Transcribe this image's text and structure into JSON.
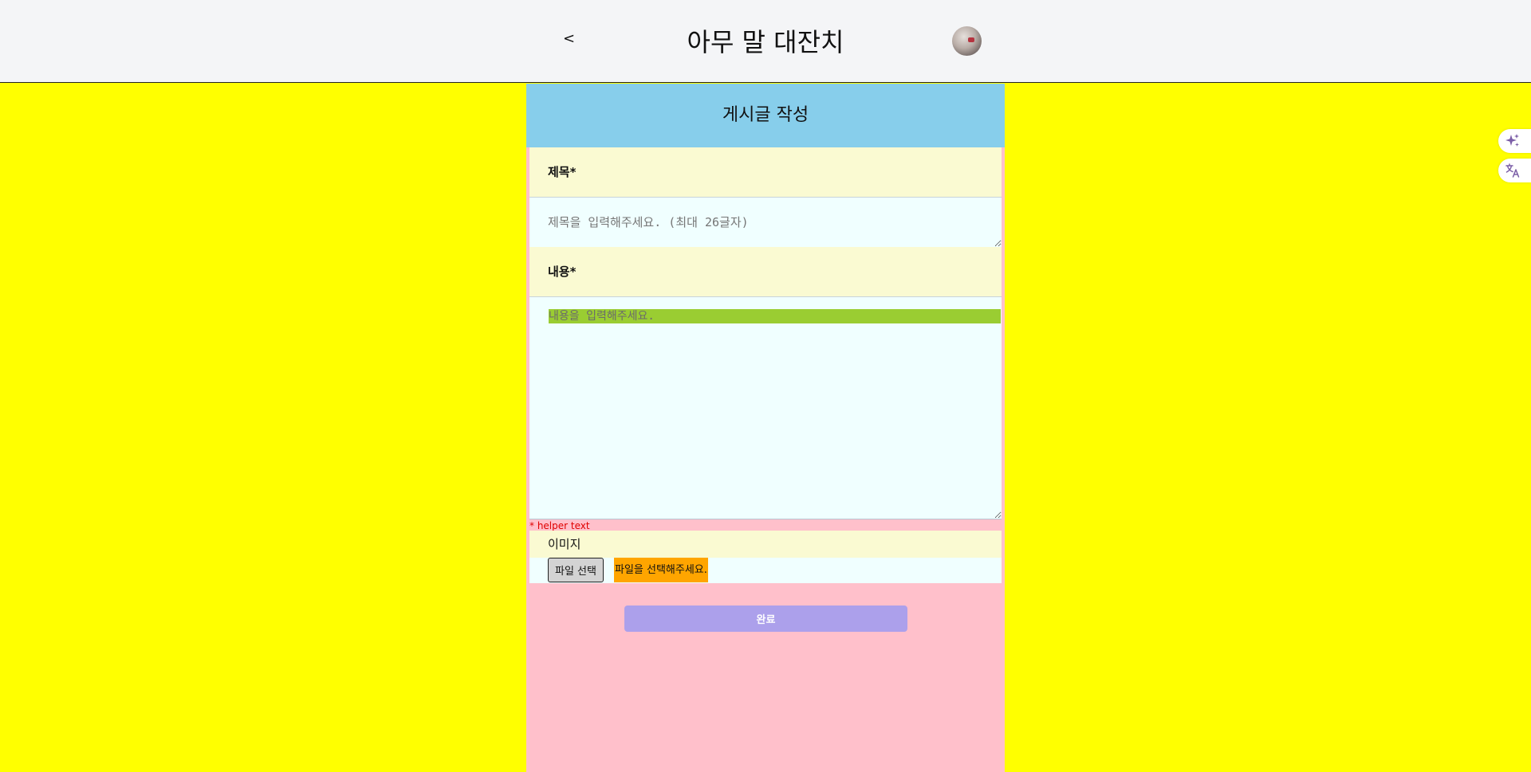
{
  "header": {
    "back_label": "<",
    "title": "아무 말 대잔치"
  },
  "form": {
    "heading": "게시글 작성",
    "title_label": "제목",
    "title_required": "*",
    "title_placeholder": "제목을 입력해주세요. (최대 26글자)",
    "title_value": "",
    "content_label": "내용",
    "content_required": "*",
    "content_placeholder": "내용을 입력해주세요.",
    "content_value": "",
    "helper_text": "* helper text",
    "image_label": "이미지",
    "file_button_label": "파일 선택",
    "file_status": "파일을 선택해주세요.",
    "submit_label": "완료"
  },
  "side_tools": {
    "items": [
      {
        "icon": "sparkle-icon"
      },
      {
        "icon": "translate-icon"
      }
    ]
  },
  "colors": {
    "page_background": "#ffff00",
    "header_background": "#f4f5f7",
    "form_heading_background": "#87ceeb",
    "form_background": "#ffc0cb",
    "label_background": "#fafad2",
    "input_background": "#f0ffff",
    "content_highlight": "#9acd32",
    "file_status_background": "#ffa500",
    "submit_background": "#aca0eb",
    "helper_text": "#e00000",
    "tool_icon": "#7b5ea7"
  }
}
